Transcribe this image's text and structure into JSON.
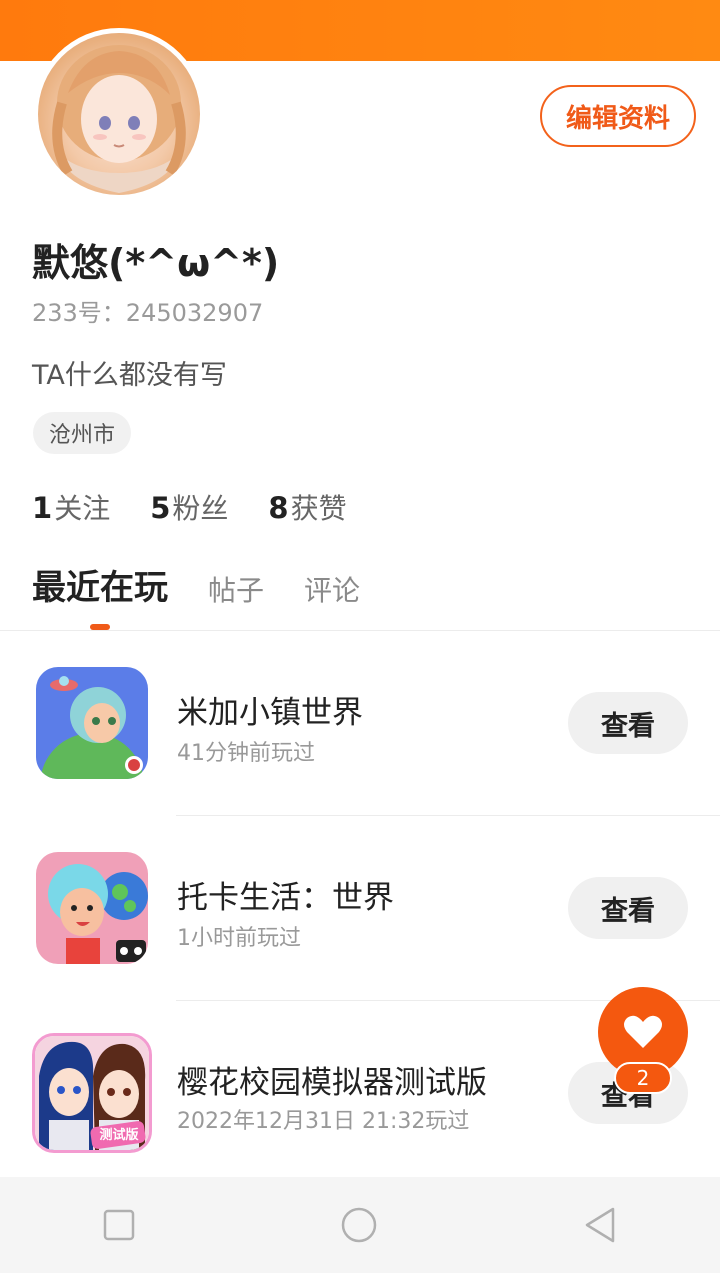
{
  "profile": {
    "nickname": "默悠(*^ω^*)",
    "uid_line": "233号：245032907",
    "bio": "TA什么都没有写",
    "location": "沧州市",
    "edit_label": "编辑资料"
  },
  "stats": [
    {
      "count": "1",
      "label": "关注"
    },
    {
      "count": "5",
      "label": "粉丝"
    },
    {
      "count": "8",
      "label": "获赞"
    }
  ],
  "tabs": [
    {
      "label": "最近在玩",
      "active": true
    },
    {
      "label": "帖子",
      "active": false
    },
    {
      "label": "评论",
      "active": false
    }
  ],
  "games": [
    {
      "title": "米加小镇世界",
      "time": "41分钟前玩过",
      "action": "查看",
      "icon": "miga-town-icon"
    },
    {
      "title": "托卡生活：世界",
      "time": "1小时前玩过",
      "action": "查看",
      "icon": "toca-life-icon"
    },
    {
      "title": "樱花校园模拟器测试版",
      "time": "2022年12月31日 21:32玩过",
      "action": "查看",
      "icon": "sakura-school-icon",
      "icon_badge": "测试版"
    }
  ],
  "fab": {
    "icon": "heart-icon",
    "badge": "2"
  },
  "nav": {
    "icons": [
      "square-icon",
      "circle-icon",
      "triangle-back-icon"
    ]
  },
  "colors": {
    "accent": "#f4580f",
    "header": "#ff7a0d"
  }
}
